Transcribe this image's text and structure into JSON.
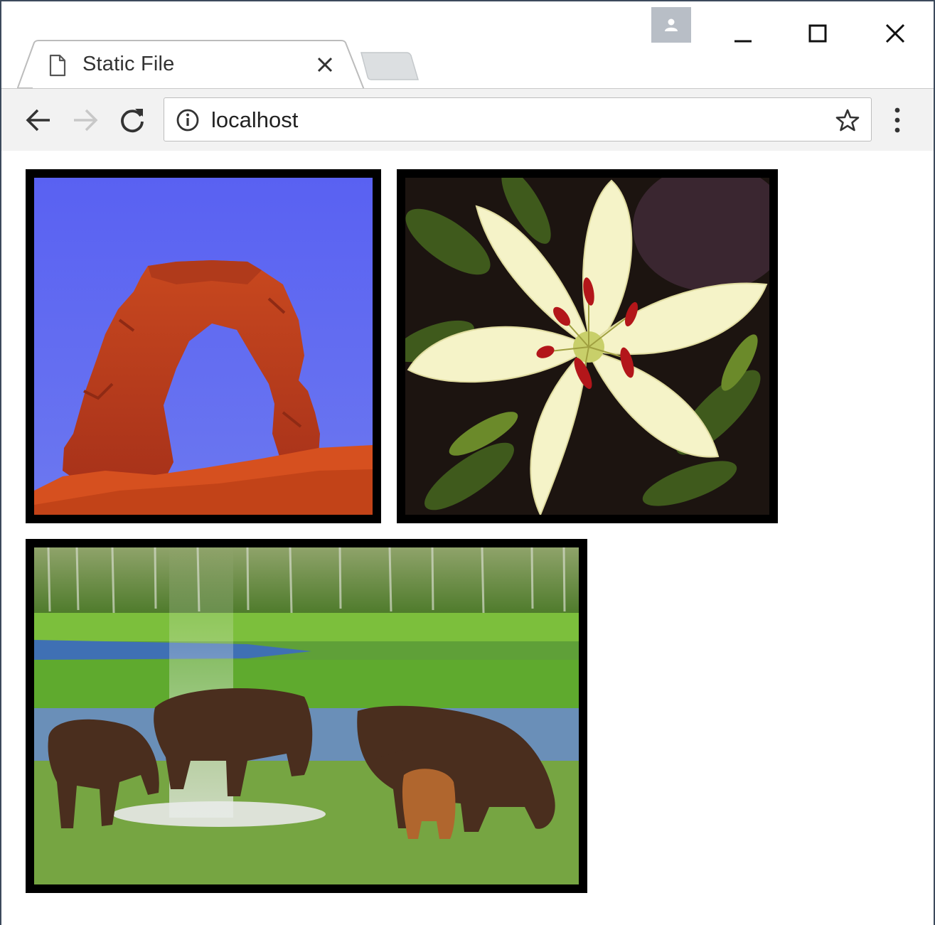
{
  "window": {
    "tab": {
      "title": "Static File"
    },
    "controls": [
      "minimize",
      "maximize",
      "close"
    ]
  },
  "toolbar": {
    "address": {
      "value": "localhost"
    }
  },
  "icons": {
    "profile": "profile-icon",
    "tab_file": "file-icon",
    "tab_close": "close-icon",
    "back": "arrow-left-icon",
    "forward": "arrow-right-icon",
    "reload": "reload-icon",
    "site_info": "info-icon",
    "bookmark": "star-icon",
    "menu": "kebab-menu-icon"
  },
  "colors": {
    "image_border": "#000000",
    "toolbar_bg": "#f2f2f2",
    "profile_bg": "#b8bec6"
  },
  "page": {
    "images": [
      {
        "subject": "sandstone arch"
      },
      {
        "subject": "white lily"
      },
      {
        "subject": "bison herd"
      }
    ]
  }
}
